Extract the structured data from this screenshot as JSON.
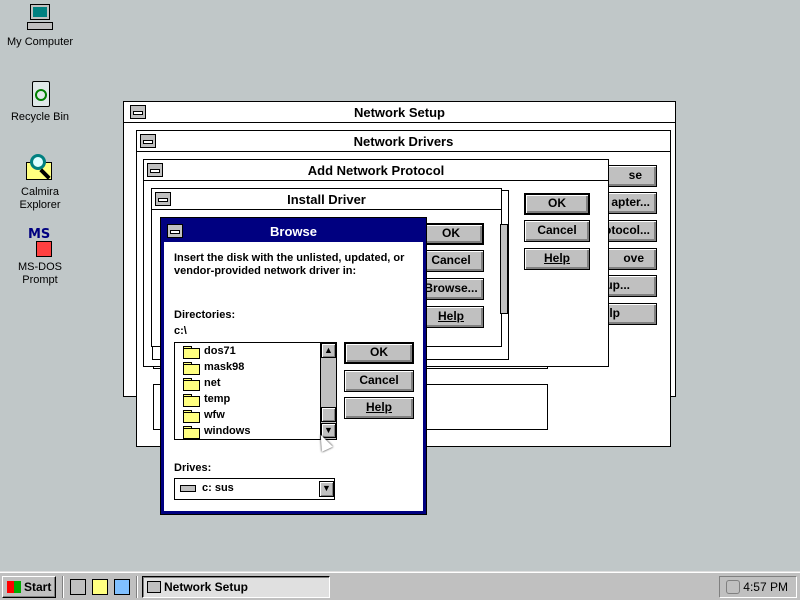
{
  "desktop": {
    "icons": [
      {
        "label": "My Computer"
      },
      {
        "label": "Recycle Bin"
      },
      {
        "label": "Calmira Explorer"
      },
      {
        "label": "MS-DOS Prompt"
      }
    ],
    "icon_glyph_text": {
      "msdos": "MS"
    }
  },
  "windows": {
    "network_setup": {
      "title": "Network Setup"
    },
    "network_drivers": {
      "title": "Network Drivers",
      "buttons": [
        "se",
        "apter...",
        "otocol...",
        "ove",
        "up...",
        "lp"
      ]
    },
    "add_protocol": {
      "title": "Add Network Protocol",
      "buttons": [
        "OK",
        "Cancel",
        "Help"
      ]
    },
    "install_driver": {
      "title": "Install Driver",
      "buttons": [
        "OK",
        "Cancel",
        "Browse...",
        "Help"
      ]
    },
    "browse": {
      "title": "Browse",
      "prompt": "Insert the disk with the unlisted, updated, or vendor-provided network driver in:",
      "directories_label": "Directories:",
      "current_path": "c:\\",
      "folders": [
        "dos71",
        "mask98",
        "net",
        "temp",
        "wfw",
        "windows"
      ],
      "drives_label": "Drives:",
      "drive_value": "c: sus",
      "buttons": {
        "ok": "OK",
        "cancel": "Cancel",
        "help": "Help"
      }
    }
  },
  "taskbar": {
    "start_label": "Start",
    "task_label": "Network Setup",
    "clock": "4:57 PM"
  },
  "colors": {
    "desktop": "#c0c7c8",
    "title_active": "#000080",
    "button_face": "#c0c0c0"
  }
}
